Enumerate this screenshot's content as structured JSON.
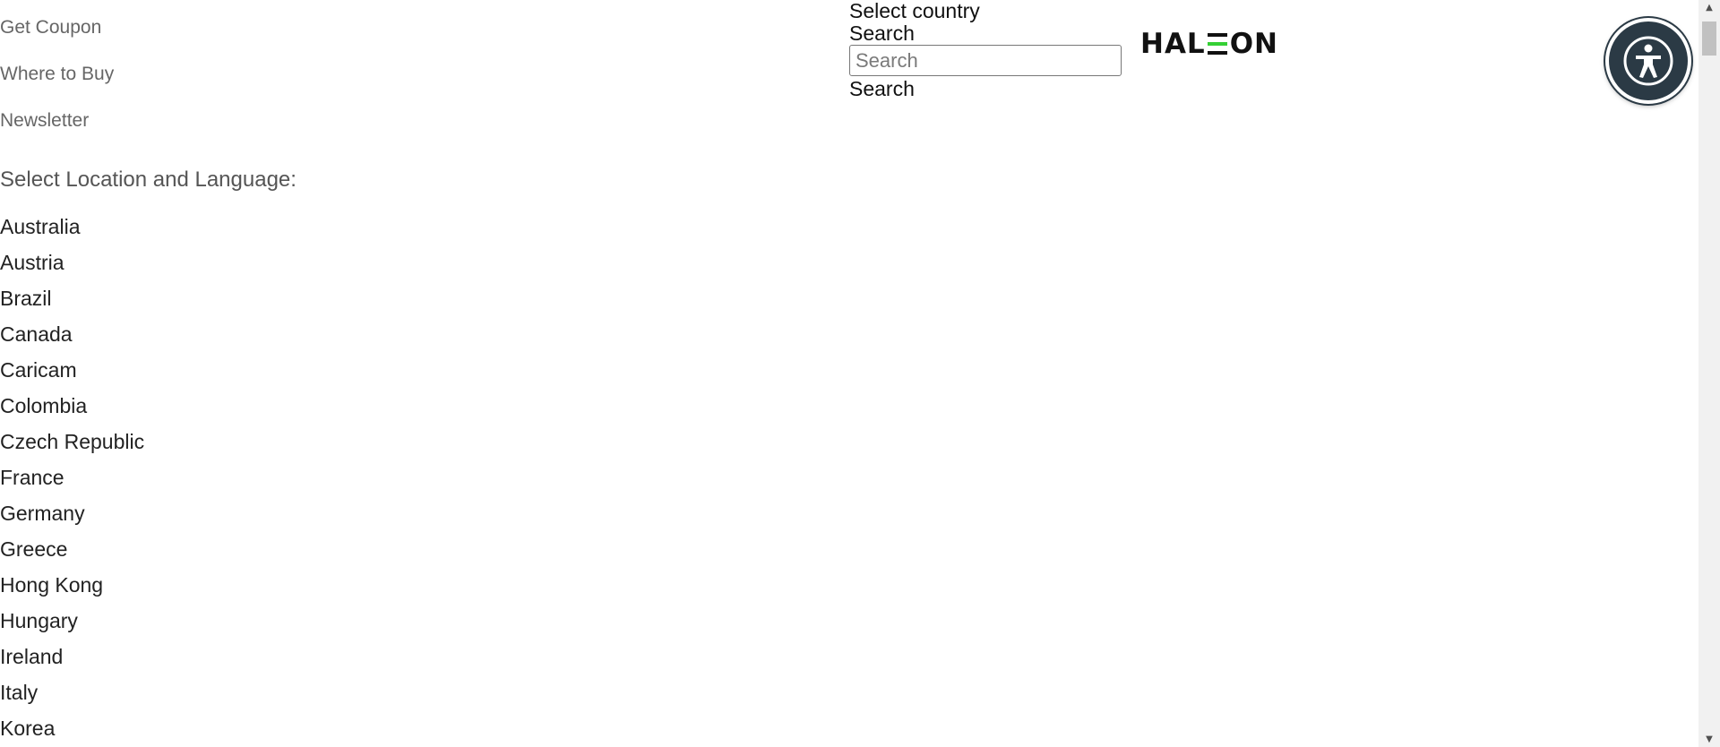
{
  "nav": {
    "links": [
      "Get Coupon",
      "Where to Buy",
      "Newsletter"
    ]
  },
  "location": {
    "heading": "Select Location and Language:",
    "countries": [
      "Australia",
      "Austria",
      "Brazil",
      "Canada",
      "Caricam",
      "Colombia",
      "Czech Republic",
      "France",
      "Germany",
      "Greece",
      "Hong Kong",
      "Hungary",
      "Ireland",
      "Italy",
      "Korea"
    ]
  },
  "search": {
    "country_label": "Select country",
    "label": "Search",
    "placeholder": "Search",
    "button": "Search"
  },
  "logo": {
    "text_before": "HAL",
    "text_after": "ON",
    "accent_color": "#35d035"
  },
  "accessibility": {
    "icon": "accessibility-icon",
    "color": "#2b3a45"
  },
  "scrollbar": {
    "up_icon": "▲",
    "down_icon": "▼"
  }
}
